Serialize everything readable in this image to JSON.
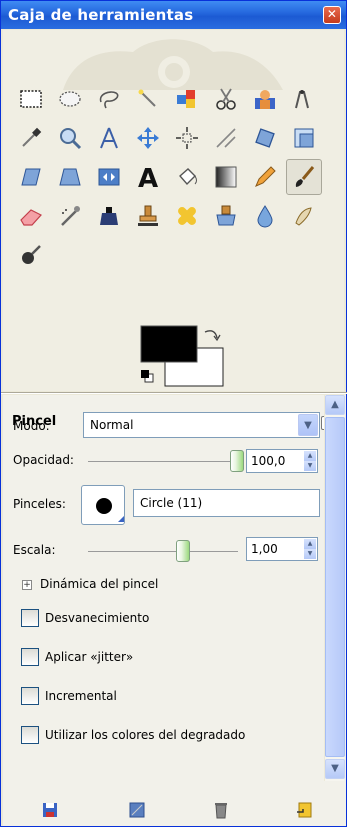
{
  "window": {
    "title": "Caja de herramientas"
  },
  "tools": [
    {
      "name": "rect-select-icon"
    },
    {
      "name": "ellipse-select-icon"
    },
    {
      "name": "free-select-icon"
    },
    {
      "name": "fuzzy-select-icon"
    },
    {
      "name": "color-select-icon"
    },
    {
      "name": "scissors-select-icon"
    },
    {
      "name": "foreground-select-icon"
    },
    {
      "name": "paths-icon"
    },
    {
      "name": "color-picker-icon"
    },
    {
      "name": "zoom-icon"
    },
    {
      "name": "measure-icon"
    },
    {
      "name": "move-icon"
    },
    {
      "name": "align-icon"
    },
    {
      "name": "crop-icon"
    },
    {
      "name": "rotate-icon"
    },
    {
      "name": "scale-icon"
    },
    {
      "name": "shear-icon"
    },
    {
      "name": "perspective-icon"
    },
    {
      "name": "flip-icon"
    },
    {
      "name": "text-icon"
    },
    {
      "name": "bucket-fill-icon"
    },
    {
      "name": "blend-icon"
    },
    {
      "name": "pencil-icon"
    },
    {
      "name": "paintbrush-icon"
    },
    {
      "name": "eraser-icon"
    },
    {
      "name": "airbrush-icon"
    },
    {
      "name": "ink-icon"
    },
    {
      "name": "clone-icon"
    },
    {
      "name": "heal-icon"
    },
    {
      "name": "perspective-clone-icon"
    },
    {
      "name": "blur-sharpen-icon"
    },
    {
      "name": "smudge-icon"
    },
    {
      "name": "dodge-burn-icon"
    }
  ],
  "colors": {
    "foreground": "#000000",
    "background": "#ffffff"
  },
  "options": {
    "title": "Pincel",
    "mode_label": "Modo:",
    "mode_value": "Normal",
    "opacity_label": "Opacidad:",
    "opacity_value": "100,0",
    "opacity_fraction": 1.0,
    "brushes_label": "Pinceles:",
    "brush_name": "Circle (11)",
    "scale_label": "Escala:",
    "scale_value": "1,00",
    "brush_dynamics": "Dinámica del pincel",
    "fade": "Desvanecimiento",
    "jitter": "Aplicar «jitter»",
    "incremental": "Incremental",
    "gradient_colors": "Utilizar los colores del degradado"
  },
  "bottom": [
    {
      "name": "save-options-icon"
    },
    {
      "name": "restore-options-icon"
    },
    {
      "name": "delete-options-icon"
    },
    {
      "name": "reset-options-icon"
    }
  ]
}
